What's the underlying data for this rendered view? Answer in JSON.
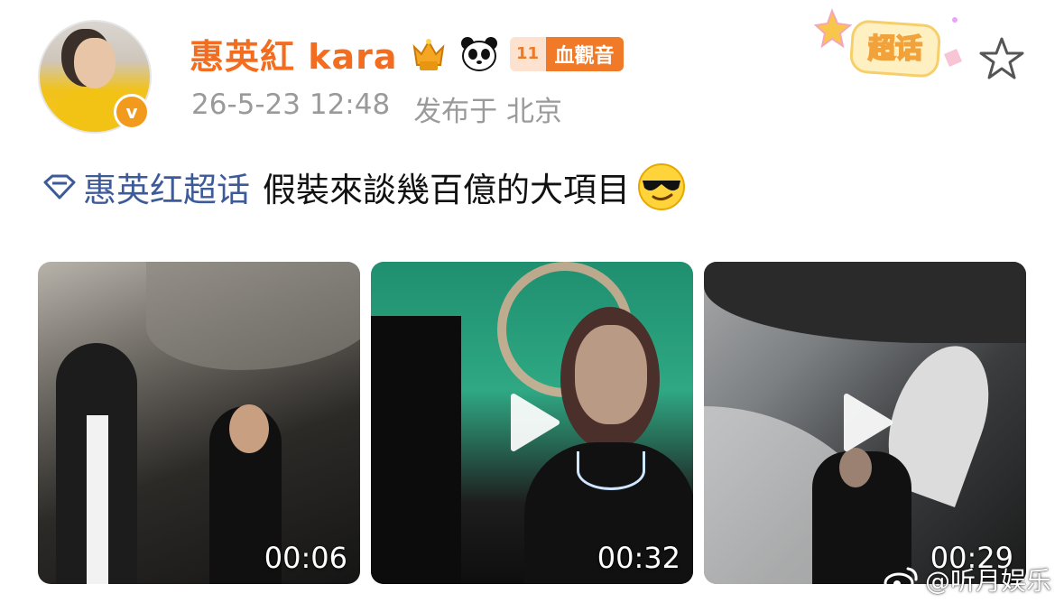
{
  "post": {
    "username": "惠英紅 kara",
    "fan_badge": {
      "level": "11",
      "label": "血觀音"
    },
    "timestamp": "26-5-23 12:48",
    "location": "发布于 北京",
    "sticker_label": "超话",
    "topic": "惠英红超话",
    "text": "假裝來談幾百億的大項目"
  },
  "videos": [
    {
      "duration": "00:06"
    },
    {
      "duration": "00:32"
    },
    {
      "duration": "00:29"
    }
  ],
  "watermark": "@听月娱乐",
  "colors": {
    "username": "#f26d1f",
    "topic": "#3d5a99",
    "meta": "#9a9a9a",
    "badge": "#f07a28"
  },
  "icons": [
    "verified-icon",
    "crown-icon",
    "panda-icon",
    "fan-badge-icon",
    "chaohua-sticker",
    "star-icon",
    "diamond-icon",
    "cool-emoji",
    "play-icon",
    "weibo-icon"
  ]
}
